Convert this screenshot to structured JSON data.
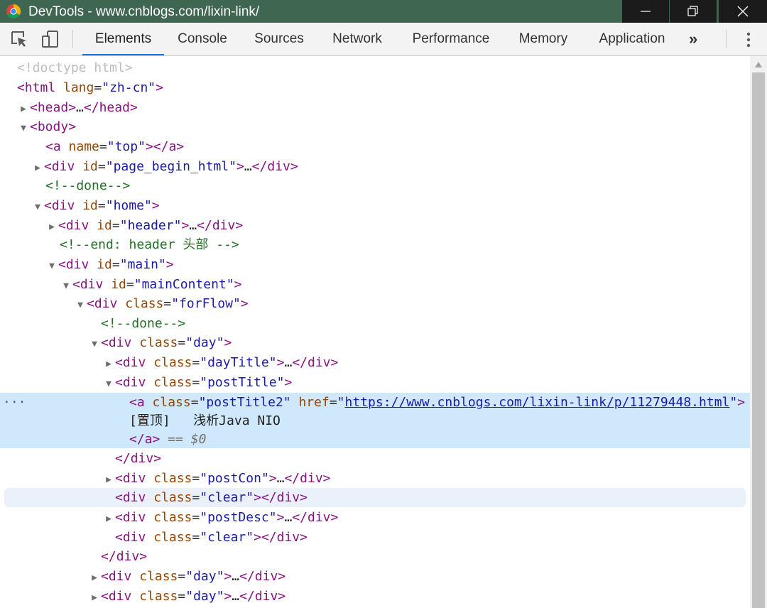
{
  "window": {
    "title": "DevTools - www.cnblogs.com/lixin-link/",
    "icons": [
      "chrome-logo",
      "minimize-icon",
      "restore-icon",
      "close-icon"
    ]
  },
  "toolbar": {
    "tabs": [
      "Elements",
      "Console",
      "Sources",
      "Network",
      "Performance",
      "Memory",
      "Application"
    ],
    "active_tab": "Elements",
    "more": "»"
  },
  "dom": {
    "doctype": "<!doctype html>",
    "html_tag": "html",
    "lang_attr": "lang",
    "lang_value": "zh-cn",
    "head": "head",
    "body": "body",
    "a_tag": "a",
    "name_attr": "name",
    "top_value": "top",
    "div": "div",
    "id_attr": "id",
    "class_attr": "class",
    "href_attr": "href",
    "page_begin": "page_begin_html",
    "done_comment": "<!--done-->",
    "home": "home",
    "header": "header",
    "header_comment": "<!--end: header 头部 -->",
    "main": "main",
    "mainContent": "mainContent",
    "forFlow": "forFlow",
    "day": "day",
    "dayTitle": "dayTitle",
    "postTitle": "postTitle",
    "postTitle2": "postTitle2",
    "post_href": "https://www.cnblogs.com/lixin-link/p/11279448.html",
    "post_text": "[置顶]   浅析Java NIO",
    "dollar_zero": "== $0",
    "postCon": "postCon",
    "clear": "clear",
    "postDesc": "postDesc",
    "ellipsis": "…",
    "row_dots": "···"
  }
}
